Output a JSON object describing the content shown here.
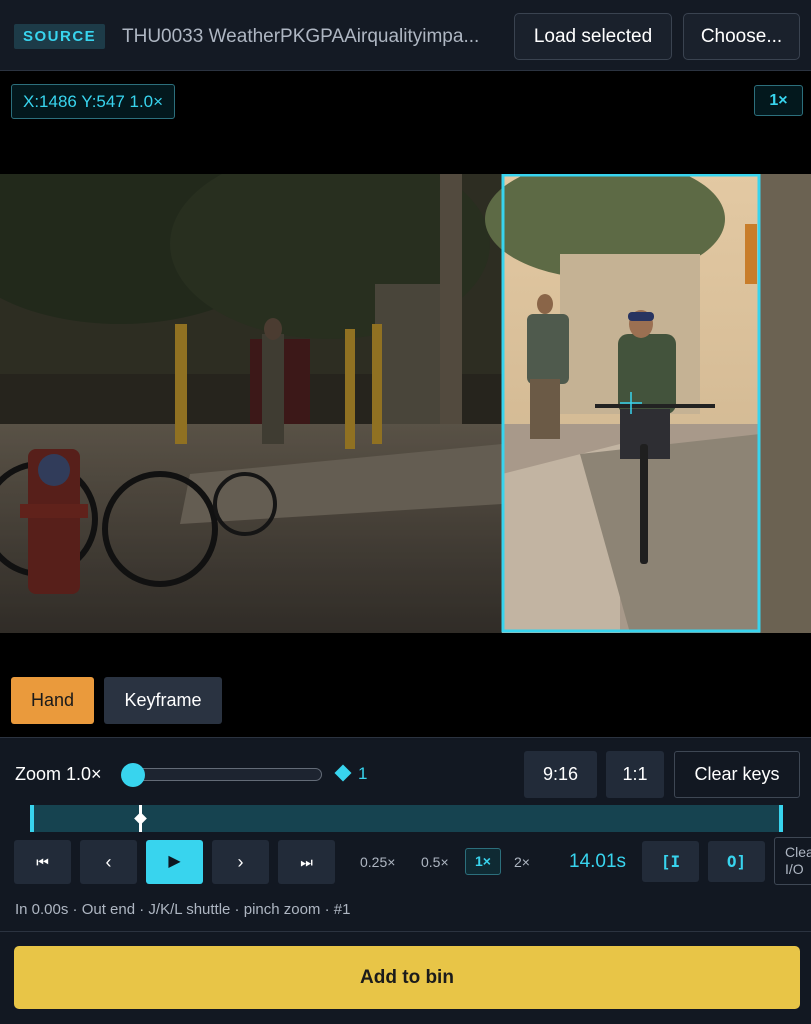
{
  "source": {
    "badge": "SOURCE",
    "title": "THU0033 WeatherPKGPAAirqualityimpa...",
    "load_label": "Load selected",
    "choose_label": "Choose..."
  },
  "viewer": {
    "coordinate_readout": "X:1486 Y:547 1.0×",
    "zoom_badge": "1×",
    "mode_buttons": {
      "hand": "Hand",
      "keyframe": "Keyframe"
    },
    "active_mode": "hand"
  },
  "controls": {
    "zoom_label": "Zoom 1.0×",
    "zoom_value": 1.0,
    "keyframe_count": "1",
    "aspect_916": "9:16",
    "aspect_11": "1:1",
    "clear_keys": "Clear keys",
    "transport": {
      "first_icon": "⏮",
      "prev_icon": "‹",
      "play_icon": "▶",
      "next_icon": "›",
      "last_icon": "⏭"
    },
    "speeds": [
      "0.25×",
      "0.5×",
      "1×",
      "2×"
    ],
    "active_speed": "1×",
    "timecode": "14.01s",
    "in_button": "[I",
    "out_button": "O]",
    "clear_io": "Clear I/O",
    "status": "In 0.00s · Out end · J/K/L shuttle · pinch zoom · #1"
  },
  "add_to_bin": "Add to bin",
  "colors": {
    "accent_cyan": "#38d4ee",
    "hand_orange": "#ea9a3c",
    "add_yellow": "#e8c547",
    "panel_bg": "#121822"
  }
}
